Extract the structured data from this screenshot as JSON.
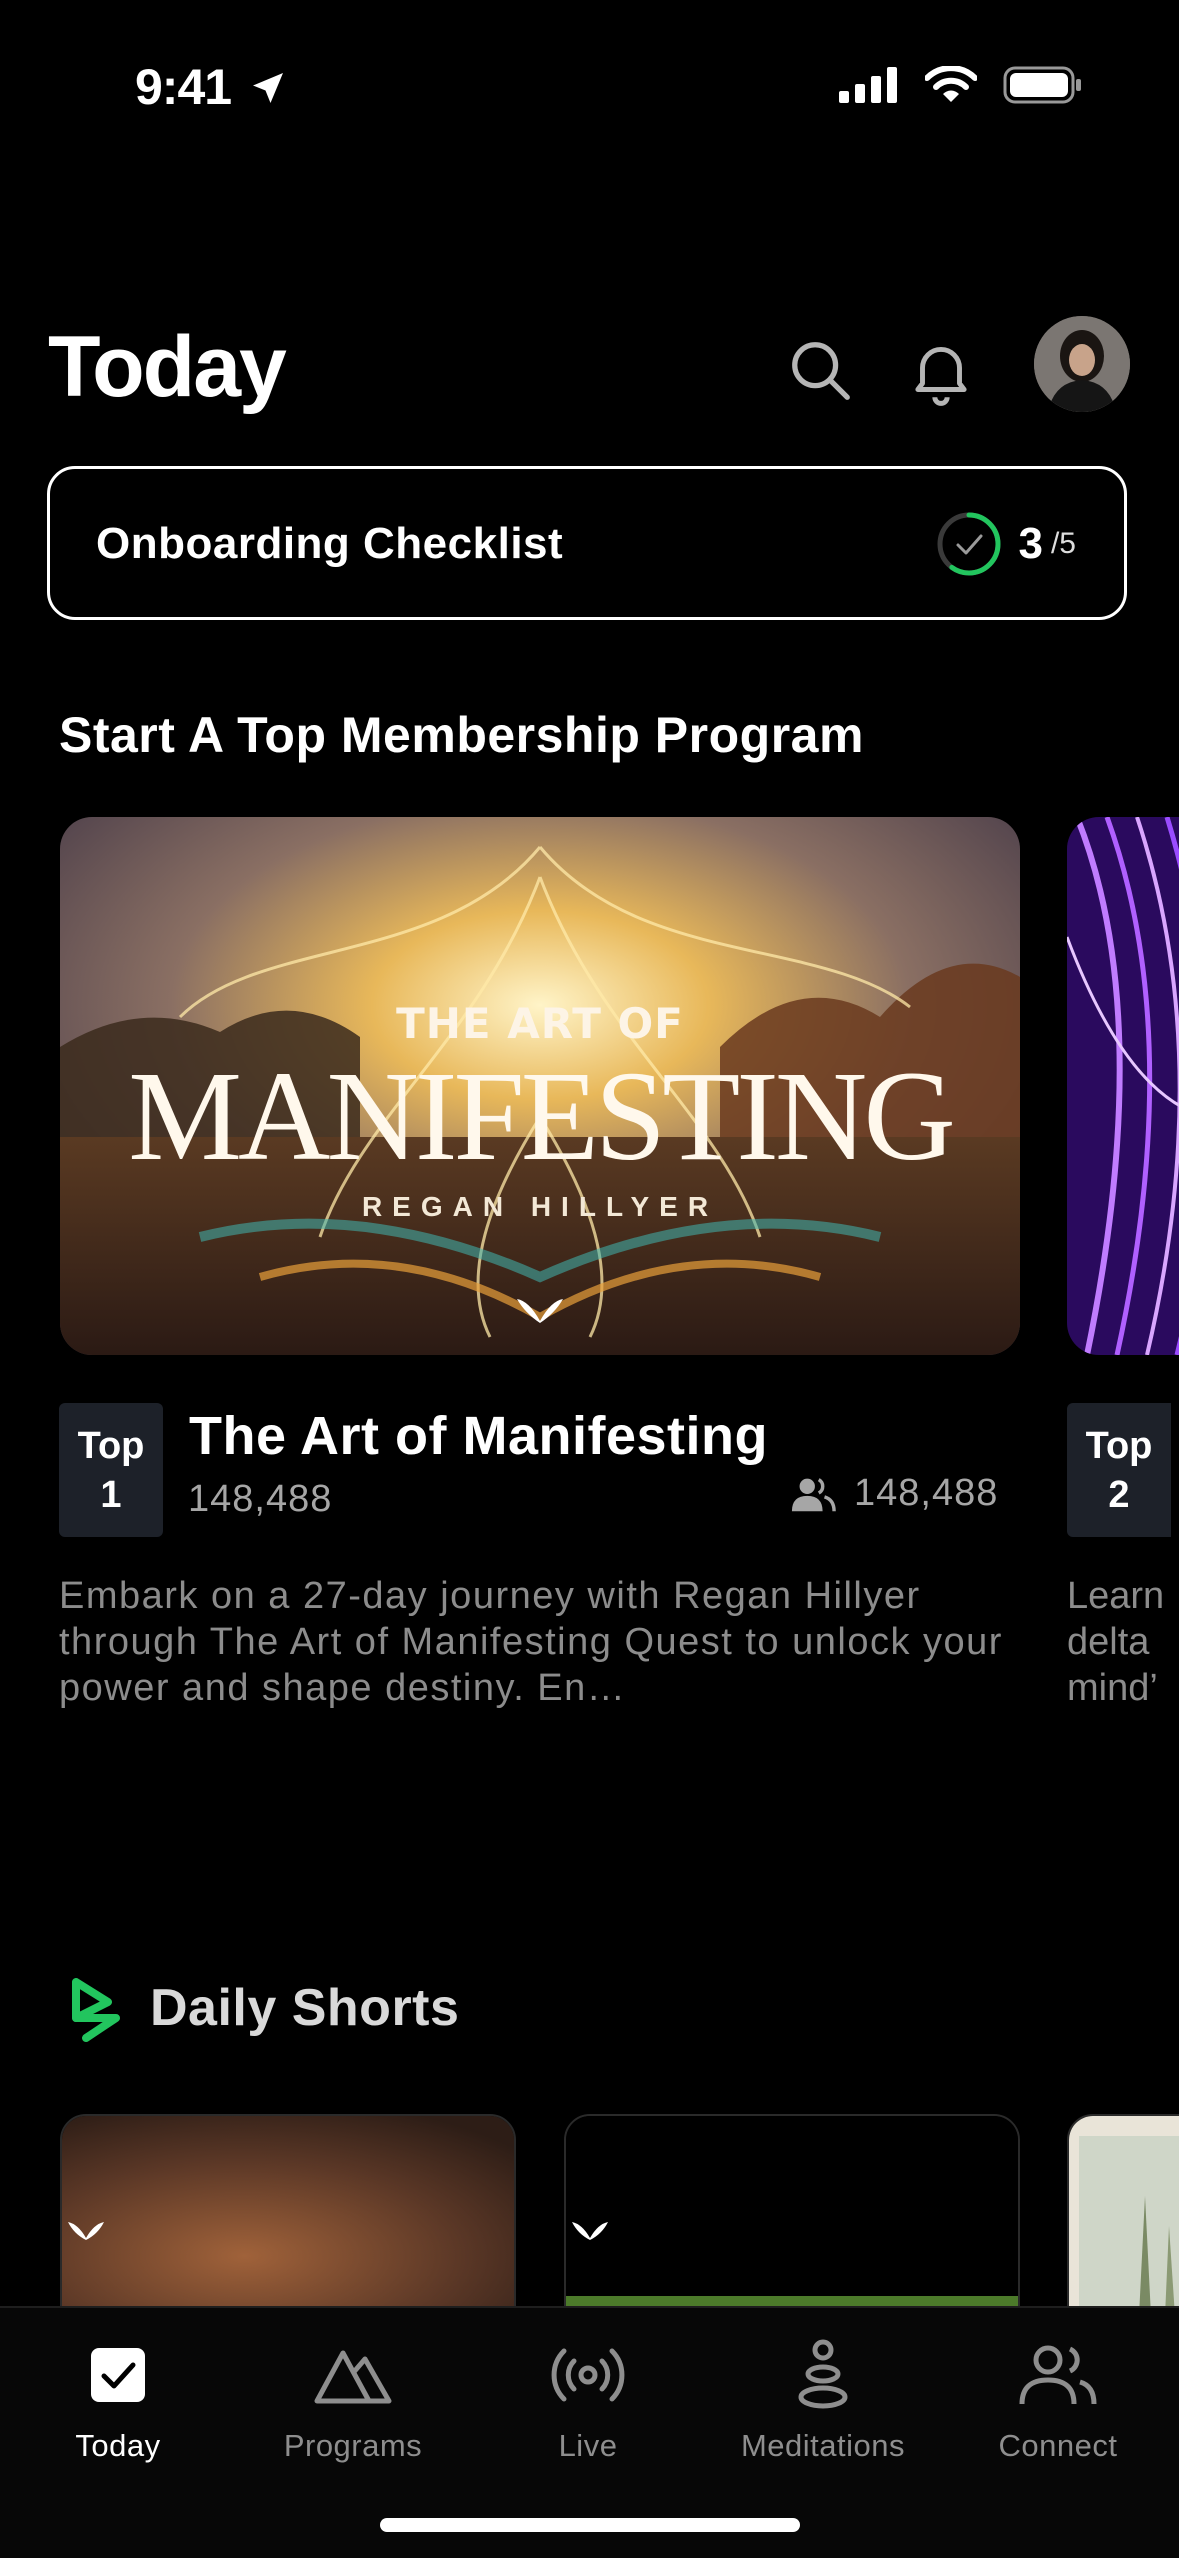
{
  "status_bar": {
    "time": "9:41"
  },
  "header": {
    "title": "Today"
  },
  "checklist": {
    "title": "Onboarding Checklist",
    "completed": "3",
    "total": "/5",
    "progress_fraction": 0.6
  },
  "programs_section": {
    "title": "Start A Top Membership Program",
    "cards": [
      {
        "rank_label": "Top",
        "rank_number": "1",
        "cover_title_top": "THE ART OF",
        "cover_title_main": "MANIFESTING",
        "cover_author": "REGAN HILLYER",
        "title": "The Art of Manifesting",
        "count": "148,488",
        "members": "148,488",
        "description": "Embark on a 27-day journey with Regan Hillyer through The Art of Manifesting Quest to unlock your power and shape destiny. En…"
      },
      {
        "rank_label": "Top",
        "rank_number": "2",
        "description_lines": [
          "Learn",
          "delta",
          "mind’"
        ]
      }
    ]
  },
  "shorts_section": {
    "title": "Daily Shorts"
  },
  "tab_bar": {
    "tabs": [
      {
        "label": "Today",
        "icon": "checkbox-icon",
        "active": true
      },
      {
        "label": "Programs",
        "icon": "mountain-icon",
        "active": false
      },
      {
        "label": "Live",
        "icon": "broadcast-icon",
        "active": false
      },
      {
        "label": "Meditations",
        "icon": "meditation-icon",
        "active": false
      },
      {
        "label": "Connect",
        "icon": "people-icon",
        "active": false
      }
    ]
  },
  "colors": {
    "accent_green": "#22c55e",
    "background": "#000000",
    "muted_text": "#8c8c8c"
  }
}
